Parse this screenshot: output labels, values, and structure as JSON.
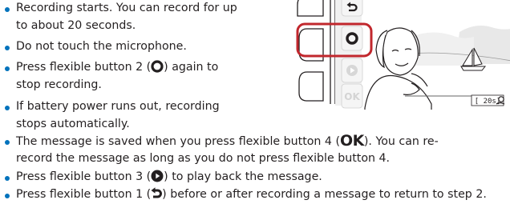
{
  "bullets": [
    {
      "lines": [
        "Recording starts. You can record for up",
        "to about 20 seconds."
      ]
    },
    {
      "lines": [
        "Do not touch the microphone."
      ]
    },
    {
      "lines": [
        "Press flexible button 2 (",
        ") again to",
        "stop recording."
      ]
    },
    {
      "lines": [
        "If battery power runs out, recording",
        "stops automatically."
      ]
    },
    {
      "lines": [
        "The message is saved when you press flexible button 4 (",
        "OK",
        "). You can re-",
        "record the message as long as you do not press flexible button 4."
      ]
    },
    {
      "lines": [
        "Press flexible button 3 (",
        ") to play back the message."
      ]
    },
    {
      "lines": [
        "Press flexible button 1 (",
        ") before or after recording a message to return to step 2."
      ]
    }
  ],
  "screen": {
    "buttons": [
      "back-arrow-icon",
      "record-circle-icon",
      "play-icon",
      "OK"
    ],
    "ok_label": "OK",
    "counter": "[ 20s]",
    "highlight_color": "#c1272d",
    "bullet_color": "#0072bc"
  }
}
